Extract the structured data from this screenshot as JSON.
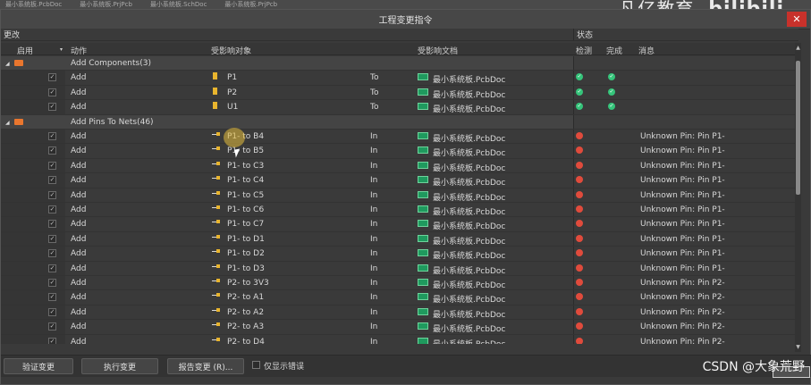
{
  "tabstrip": [
    "最小系统板.PcbDoc",
    "最小系统板.PrjPcb",
    "最小系统板.SchDoc",
    "最小系统板.PrjPcb"
  ],
  "watermark_top": {
    "text": "凡亿教育",
    "bili": "bilibili"
  },
  "dialog": {
    "title": "工程变更指令",
    "close": "✕"
  },
  "sections": {
    "changes": "更改",
    "status": "状态"
  },
  "columns": {
    "enable": "启用",
    "action": "动作",
    "affected_object": "受影响对象",
    "affected_doc": "受影响文档",
    "check": "检测",
    "done": "完成",
    "message": "消息"
  },
  "groups": [
    {
      "title": "Add Components(3)"
    },
    {
      "title": "Add Pins To Nets(46)"
    }
  ],
  "component_rows": [
    {
      "action": "Add",
      "object": "P1",
      "dir": "To",
      "doc": "最小系统板.PcbDoc"
    },
    {
      "action": "Add",
      "object": "P2",
      "dir": "To",
      "doc": "最小系统板.PcbDoc"
    },
    {
      "action": "Add",
      "object": "U1",
      "dir": "To",
      "doc": "最小系统板.PcbDoc"
    }
  ],
  "pin_rows": [
    {
      "action": "Add",
      "object": "P1- to B4",
      "dir": "In",
      "doc": "最小系统板.PcbDoc",
      "message": "Unknown Pin: Pin P1-"
    },
    {
      "action": "Add",
      "object": "P1- to B5",
      "dir": "In",
      "doc": "最小系统板.PcbDoc",
      "message": "Unknown Pin: Pin P1-"
    },
    {
      "action": "Add",
      "object": "P1- to C3",
      "dir": "In",
      "doc": "最小系统板.PcbDoc",
      "message": "Unknown Pin: Pin P1-"
    },
    {
      "action": "Add",
      "object": "P1- to C4",
      "dir": "In",
      "doc": "最小系统板.PcbDoc",
      "message": "Unknown Pin: Pin P1-"
    },
    {
      "action": "Add",
      "object": "P1- to C5",
      "dir": "In",
      "doc": "最小系统板.PcbDoc",
      "message": "Unknown Pin: Pin P1-"
    },
    {
      "action": "Add",
      "object": "P1- to C6",
      "dir": "In",
      "doc": "最小系统板.PcbDoc",
      "message": "Unknown Pin: Pin P1-"
    },
    {
      "action": "Add",
      "object": "P1- to C7",
      "dir": "In",
      "doc": "最小系统板.PcbDoc",
      "message": "Unknown Pin: Pin P1-"
    },
    {
      "action": "Add",
      "object": "P1- to D1",
      "dir": "In",
      "doc": "最小系统板.PcbDoc",
      "message": "Unknown Pin: Pin P1-"
    },
    {
      "action": "Add",
      "object": "P1- to D2",
      "dir": "In",
      "doc": "最小系统板.PcbDoc",
      "message": "Unknown Pin: Pin P1-"
    },
    {
      "action": "Add",
      "object": "P1- to D3",
      "dir": "In",
      "doc": "最小系统板.PcbDoc",
      "message": "Unknown Pin: Pin P1-"
    },
    {
      "action": "Add",
      "object": "P2- to 3V3",
      "dir": "In",
      "doc": "最小系统板.PcbDoc",
      "message": "Unknown Pin: Pin P2-"
    },
    {
      "action": "Add",
      "object": "P2- to A1",
      "dir": "In",
      "doc": "最小系统板.PcbDoc",
      "message": "Unknown Pin: Pin P2-"
    },
    {
      "action": "Add",
      "object": "P2- to A2",
      "dir": "In",
      "doc": "最小系统板.PcbDoc",
      "message": "Unknown Pin: Pin P2-"
    },
    {
      "action": "Add",
      "object": "P2- to A3",
      "dir": "In",
      "doc": "最小系统板.PcbDoc",
      "message": "Unknown Pin: Pin P2-"
    },
    {
      "action": "Add",
      "object": "P2- to D4",
      "dir": "In",
      "doc": "最小系统板.PcbDoc",
      "message": "Unknown Pin: Pin P2-"
    }
  ],
  "buttons": {
    "validate": "验证变更",
    "execute": "执行变更",
    "report": "报告变更 (R)...",
    "only_errors": "仅显示错误"
  },
  "watermark_bottom": "CSDN @大象荒野",
  "colors": {
    "ok": "#35c47a",
    "error": "#e04b3c",
    "close": "#c8312b"
  }
}
